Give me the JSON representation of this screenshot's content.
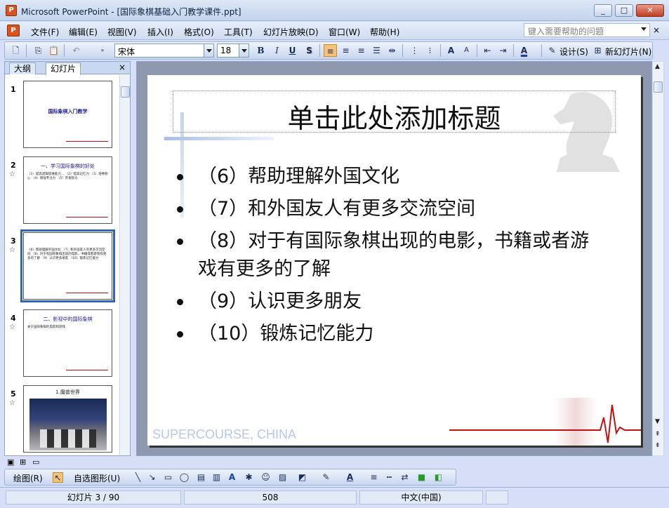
{
  "window": {
    "app_icon": "powerpoint-icon",
    "title": "Microsoft PowerPoint - [国际象棋基础入门教学课件.ppt]",
    "min": "_",
    "max": "□",
    "close": "✕"
  },
  "menu": {
    "items": [
      "文件(F)",
      "编辑(E)",
      "视图(V)",
      "插入(I)",
      "格式(O)",
      "工具(T)",
      "幻灯片放映(D)",
      "窗口(W)",
      "帮助(H)"
    ],
    "help_placeholder": "键入需要帮助的问题",
    "close": "×"
  },
  "toolbar": {
    "font_name": "宋体",
    "font_size": "18",
    "bold": "B",
    "italic": "I",
    "underline": "U",
    "shadow": "S",
    "design_label": "设计(S)",
    "new_slide_label": "新幻灯片(N)"
  },
  "panel": {
    "tabs": [
      "大纲",
      "幻灯片"
    ],
    "close": "×",
    "slides": [
      {
        "num": "1",
        "title": "国际象棋入门教学",
        "body": ""
      },
      {
        "num": "2",
        "title": "一、学习国际象棋的好处",
        "body": "（1）提高逻辑思维能力... （2）提高记忆力 （3）培养耐心 （4）增强专注力 （5）开发智力"
      },
      {
        "num": "3",
        "title": "",
        "body": "（6）帮助理解外国文化 （7）和外国友人有更多交流空间 （8）对于有国际象棋出现的电影，书籍或者游戏有更多的了解 （9）认识更多朋友 （10）锻炼记忆能力"
      },
      {
        "num": "4",
        "title": "二、影视中的国际象棋",
        "body": "关于国际象棋的电影和游戏"
      },
      {
        "num": "5",
        "title": "1.魔兽世界",
        "body": ""
      }
    ]
  },
  "slide": {
    "title": "单击此处添加标题",
    "bullets": [
      "（6）帮助理解外国文化",
      "（7）和外国友人有更多交流空间",
      "（8）对于有国际象棋出现的电影，书籍或者游戏有更多的了解",
      "（9）认识更多朋友",
      "（10）锻炼记忆能力"
    ],
    "footer": "SUPERCOURSE, CHINA"
  },
  "drawbar": {
    "draw_label": "绘图(R)",
    "autoshape_label": "自选图形(U)"
  },
  "status": {
    "slide_pos": "幻灯片 3 / 90",
    "design": "508",
    "language": "中文(中国)"
  }
}
